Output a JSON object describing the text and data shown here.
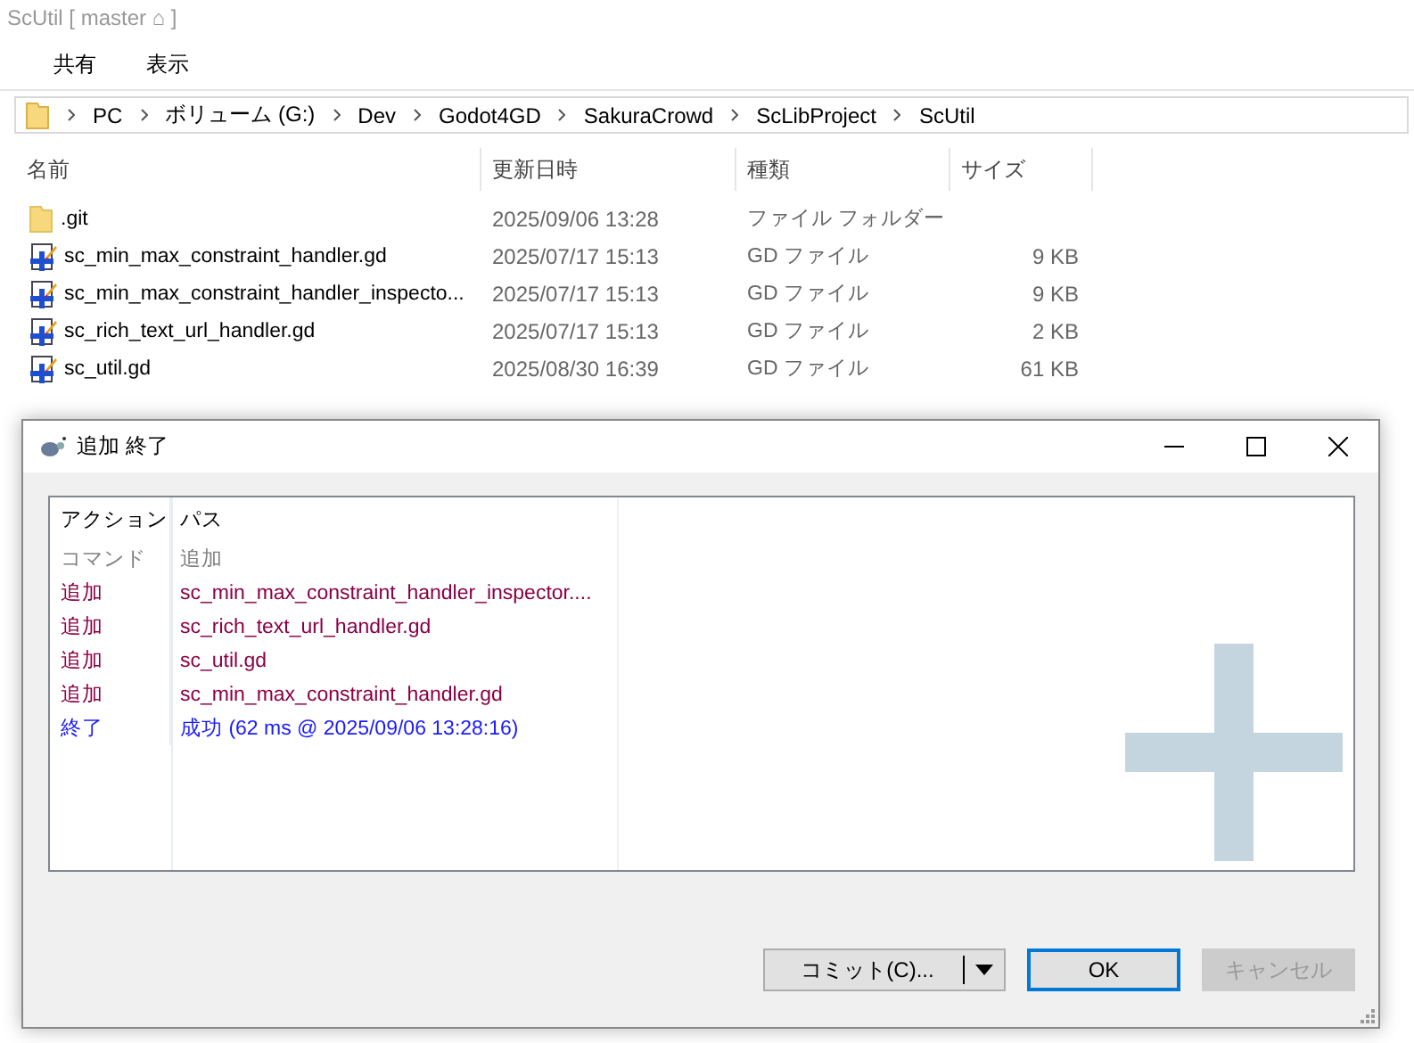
{
  "explorer": {
    "title": "ScUtil [ master ⌂ ]",
    "menu": [
      "共有",
      "表示"
    ],
    "breadcrumb": [
      "PC",
      "ボリューム (G:)",
      "Dev",
      "Godot4GD",
      "SakuraCrowd",
      "ScLibProject",
      "ScUtil"
    ],
    "columns": [
      "名前",
      "更新日時",
      "種類",
      "サイズ"
    ],
    "files": [
      {
        "kind": "folder",
        "name": ".git",
        "modified": "2025/09/06 13:28",
        "type": "ファイル フォルダー"
      },
      {
        "kind": "script",
        "name": "sc_min_max_constraint_handler.gd",
        "modified": "2025/07/17 15:13",
        "type": "GD ファイル",
        "size": "9 KB"
      },
      {
        "kind": "script",
        "name": "sc_min_max_constraint_handler_inspecto...",
        "modified": "2025/07/17 15:13",
        "type": "GD ファイル",
        "size": "9 KB"
      },
      {
        "kind": "script",
        "name": "sc_rich_text_url_handler.gd",
        "modified": "2025/07/17 15:13",
        "type": "GD ファイル",
        "size": "2 KB"
      },
      {
        "kind": "script",
        "name": "sc_util.gd",
        "modified": "2025/08/30 16:39",
        "type": "GD ファイル",
        "size": "61 KB"
      }
    ]
  },
  "dialog": {
    "title": "追加 終了",
    "columns": [
      "アクション",
      "パス"
    ],
    "log": [
      {
        "kind": "command",
        "action": "コマンド",
        "path": "追加"
      },
      {
        "kind": "add",
        "action": "追加",
        "path": "sc_min_max_constraint_handler_inspector...."
      },
      {
        "kind": "add",
        "action": "追加",
        "path": "sc_rich_text_url_handler.gd"
      },
      {
        "kind": "add",
        "action": "追加",
        "path": "sc_util.gd"
      },
      {
        "kind": "add",
        "action": "追加",
        "path": "sc_min_max_constraint_handler.gd"
      },
      {
        "kind": "end",
        "action": "終了",
        "path": "成功 (62 ms @ 2025/09/06 13:28:16)"
      }
    ],
    "buttons": [
      {
        "kind": "split",
        "label": "コミット(C)...",
        "disabled": false
      },
      {
        "kind": "default",
        "label": "OK",
        "disabled": false
      },
      {
        "kind": "plain",
        "label": "キャンセル",
        "disabled": true
      }
    ]
  }
}
